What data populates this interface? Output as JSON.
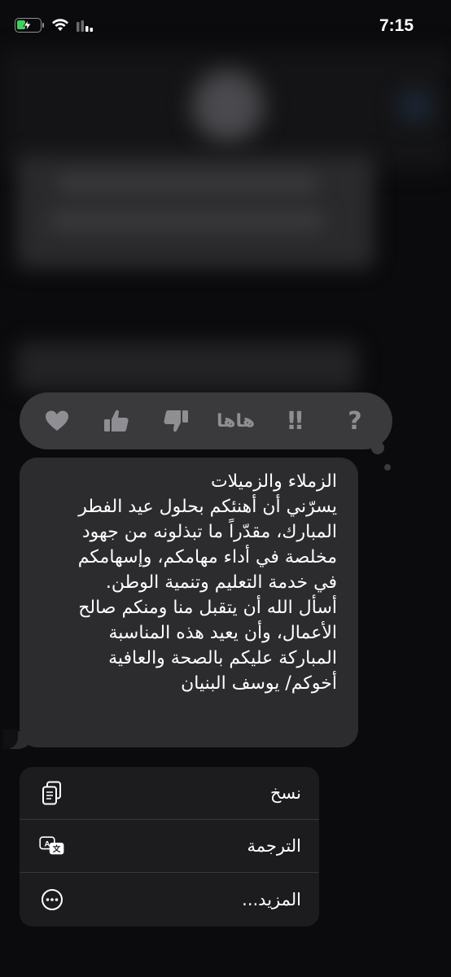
{
  "status_bar": {
    "time": "7:15"
  },
  "reactions": [
    {
      "name": "heart",
      "glyph": "♥"
    },
    {
      "name": "thumbs-up",
      "glyph": "👍"
    },
    {
      "name": "thumbs-down",
      "glyph": "👎"
    },
    {
      "name": "haha",
      "glyph": "هاها"
    },
    {
      "name": "exclamation",
      "glyph": "‼"
    },
    {
      "name": "question",
      "glyph": "?"
    }
  ],
  "message": {
    "lines": [
      "الزملاء والزميلات",
      "يسرّني أن أهنئكم بحلول عيد الفطر",
      "المبارك، مقدّراً ما تبذلونه من جهود",
      "مخلصة في أداء مهامكم، وإسهامكم",
      "في خدمة التعليم وتنمية الوطن.",
      "أسأل الله أن يتقبل منا ومنكم صالح",
      "الأعمال، وأن يعيد هذه المناسبة",
      "المباركة عليكم بالصحة والعافية",
      "أخوكم/ يوسف البنيان"
    ]
  },
  "menu": {
    "items": [
      {
        "label": "نسخ",
        "icon": "copy-icon"
      },
      {
        "label": "الترجمة",
        "icon": "translate-icon"
      },
      {
        "label": "المزيد...",
        "icon": "more-icon"
      }
    ]
  },
  "colors": {
    "background": "#0b0b0d",
    "bubble": "#2c2c2e",
    "reaction_bar": "#3a3a3c",
    "menu": "#1c1c1e",
    "battery_fill": "#3fd15c",
    "icon_gray": "#8e8e93"
  }
}
